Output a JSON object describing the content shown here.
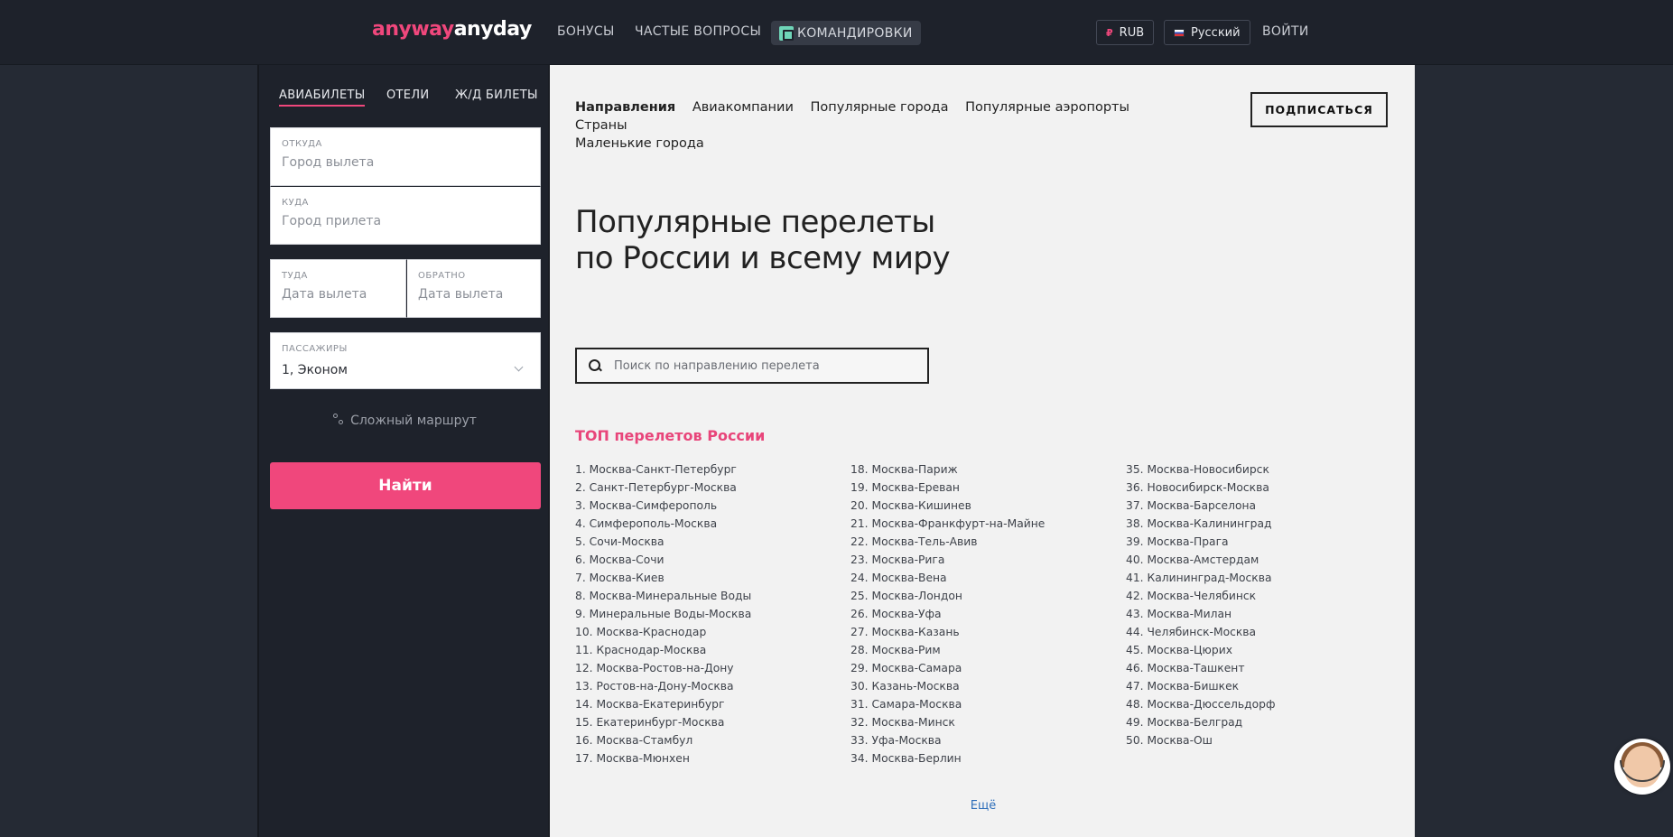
{
  "header": {
    "logo": {
      "part1": "anyway",
      "part2": "anyday"
    },
    "nav": [
      "БОНУСЫ",
      "ЧАСТЫЕ ВОПРОСЫ"
    ],
    "chip": "КОМАНДИРОВКИ",
    "currency": {
      "sign": "₽",
      "label": "RUB"
    },
    "language": "Русский",
    "login": "ВОЙТИ"
  },
  "sidebar": {
    "tabs": [
      "АВИАБИЛЕТЫ",
      "ОТЕЛИ",
      "Ж/Д БИЛЕТЫ"
    ],
    "from": {
      "label": "ОТКУДА",
      "placeholder": "Город вылета"
    },
    "to": {
      "label": "КУДА",
      "placeholder": "Город прилета"
    },
    "depart": {
      "label": "ТУДА",
      "placeholder": "Дата вылета"
    },
    "return": {
      "label": "ОБРАТНО",
      "placeholder": "Дата вылета"
    },
    "passengers": {
      "label": "ПАССАЖИРЫ",
      "value": "1, Эконом"
    },
    "complex_route": "Сложный маршрут",
    "find": "Найти"
  },
  "main": {
    "subnav": [
      "Направления",
      "Авиакомпании",
      "Популярные города",
      "Популярные аэропорты",
      "Страны",
      "Маленькие города"
    ],
    "subscribe": "ПОДПИСАТЬСЯ",
    "hero_line1": "Популярные перелеты",
    "hero_line2": "по России и всему миру",
    "search_placeholder": "Поиск по направлению перелета",
    "top_title": "ТОП перелетов России",
    "routes_col1": [
      "1. Москва-Санкт-Петербург",
      "2. Санкт-Петербург-Москва",
      "3. Москва-Симферополь",
      "4. Симферополь-Москва",
      "5. Сочи-Москва",
      "6. Москва-Сочи",
      "7. Москва-Киев",
      "8. Москва-Минеральные Воды",
      "9. Минеральные Воды-Москва",
      "10. Москва-Краснодар",
      "11. Краснодар-Москва",
      "12. Москва-Ростов-на-Дону",
      "13. Ростов-на-Дону-Москва",
      "14. Москва-Екатеринбург",
      "15. Екатеринбург-Москва",
      "16. Москва-Стамбул",
      "17. Москва-Мюнхен"
    ],
    "routes_col2": [
      "18. Москва-Париж",
      "19. Москва-Ереван",
      "20. Москва-Кишинев",
      "21. Москва-Франкфурт-на-Майне",
      "22. Москва-Тель-Авив",
      "23. Москва-Рига",
      "24. Москва-Вена",
      "25. Москва-Лондон",
      "26. Москва-Уфа",
      "27. Москва-Казань",
      "28. Москва-Рим",
      "29. Москва-Самара",
      "30. Казань-Москва",
      "31. Самара-Москва",
      "32. Москва-Минск",
      "33. Уфа-Москва",
      "34. Москва-Берлин"
    ],
    "routes_col3": [
      "35. Москва-Новосибирск",
      "36. Новосибирск-Москва",
      "37. Москва-Барселона",
      "38. Москва-Калининград",
      "39. Москва-Прага",
      "40. Москва-Амстердам",
      "41. Калининград-Москва",
      "42. Москва-Челябинск",
      "43. Москва-Милан",
      "44. Челябинск-Москва",
      "45. Москва-Цюрих",
      "46. Москва-Ташкент",
      "47. Москва-Бишкек",
      "48. Москва-Дюссельдорф",
      "49. Москва-Белград",
      "50. Москва-Ош"
    ],
    "more": "Ещё"
  },
  "colors": {
    "accent": "#f0477c",
    "header_bg": "#1e222b",
    "content_bg": "#f2f2f2"
  }
}
